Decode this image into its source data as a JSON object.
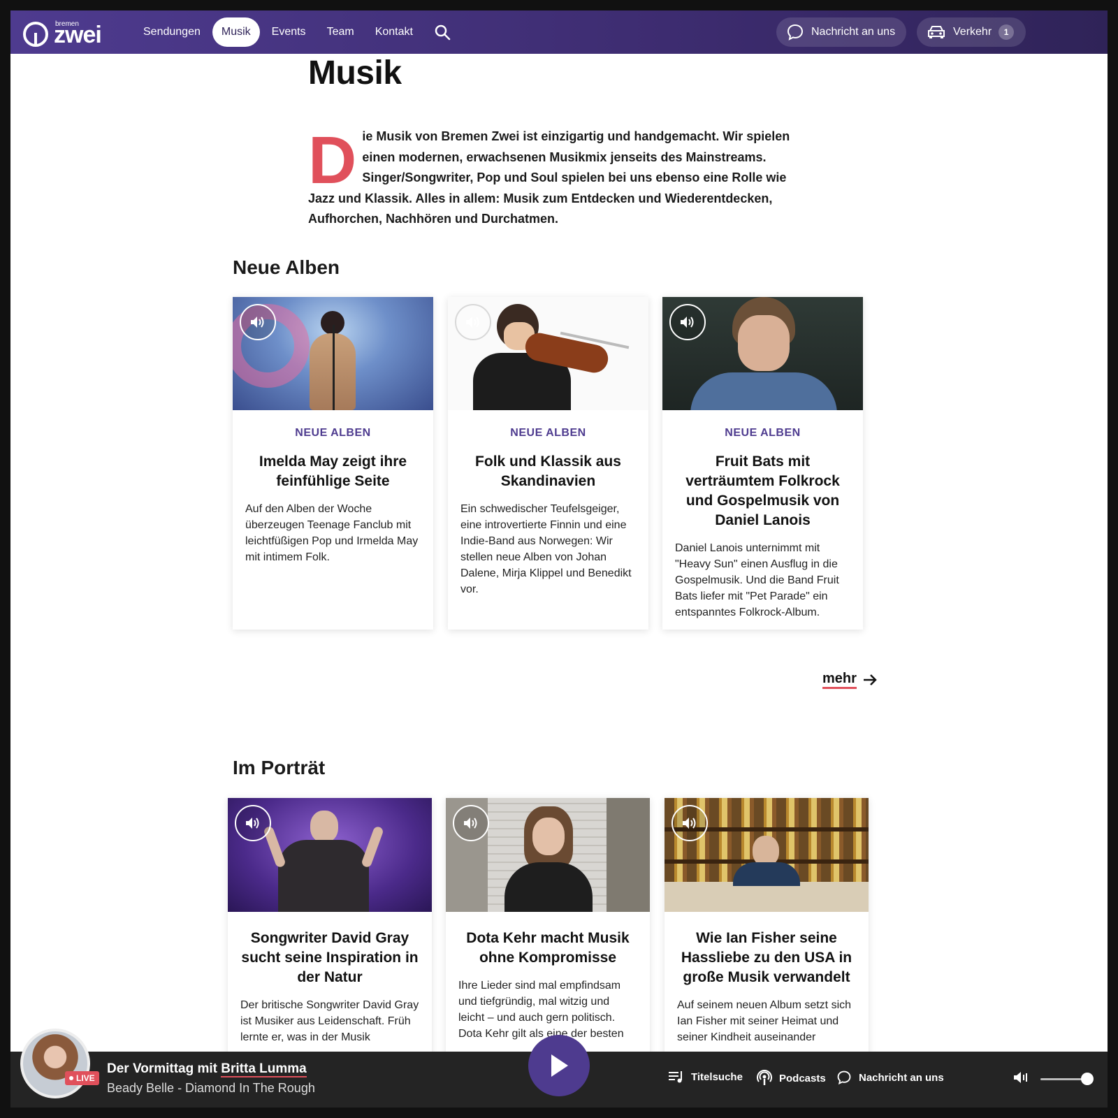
{
  "header": {
    "logo_small": "bremen",
    "logo_big": "zwei",
    "nav": [
      "Sendungen",
      "Musik",
      "Events",
      "Team",
      "Kontakt"
    ],
    "active_nav": "Musik",
    "message_label": "Nachricht an uns",
    "traffic_label": "Verkehr",
    "traffic_count": "1"
  },
  "page": {
    "title": "Musik",
    "intro_dropcap": "D",
    "intro_rest": "ie Musik von Bremen Zwei ist einzigartig und handgemacht. Wir spielen einen modernen, erwachsenen Musikmix jenseits des Mainstreams. Singer/Songwriter, Pop und Soul spielen bei uns ebenso eine Rolle wie Jazz und Klassik. Alles in allem: Musik zum Entdecken und Wiederentdecken, Aufhorchen, Nachhören und Durchatmen."
  },
  "neue_alben": {
    "section_title": "Neue Alben",
    "cards": [
      {
        "kicker": "NEUE ALBEN",
        "title": "Imelda May zeigt ihre feinfühlige Seite",
        "text": "Auf den Alben der Woche überzeugen Teenage Fanclub mit leichtfüßigen Pop und Irmelda May mit intimem Folk."
      },
      {
        "kicker": "NEUE ALBEN",
        "title": "Folk und Klassik aus Skandinavien",
        "text": "Ein schwedischer Teufelsgeiger, eine introvertierte Finnin und eine Indie-Band aus Norwegen: Wir stellen neue Alben von Johan Dalene, Mirja Klippel und Benedikt vor."
      },
      {
        "kicker": "NEUE ALBEN",
        "title": "Fruit Bats mit verträumtem Folkrock und Gospelmusik von Daniel Lanois",
        "text": "Daniel Lanois unternimmt mit \"Heavy Sun\" einen Ausflug in die Gospelmusik. Und die Band Fruit Bats liefer mit \"Pet Parade\" ein entspanntes Folkrock-Album."
      }
    ],
    "more_label": "mehr"
  },
  "portraet": {
    "section_title": "Im Porträt",
    "cards": [
      {
        "title": "Songwriter David Gray sucht seine Inspiration in der Natur",
        "text": "Der britische Songwriter David Gray ist Musiker aus Leidenschaft. Früh lernte er, was in der Musik"
      },
      {
        "title": "Dota Kehr macht Musik ohne Kompromisse",
        "text": "Ihre Lieder sind mal empfindsam und tiefgründig, mal witzig und leicht – und auch gern politisch. Dota Kehr gilt als eine der besten"
      },
      {
        "title": "Wie Ian Fisher seine Hassliebe zu den USA in große Musik verwandelt",
        "text": "Auf seinem neuen Album setzt sich Ian Fisher mit seiner Heimat und seiner Kindheit auseinander"
      }
    ]
  },
  "player": {
    "live_label": "LIVE",
    "show_prefix": "Der Vormittag mit ",
    "host": "Britta Lumma",
    "track": "Beady Belle - Diamond In The Rough",
    "links": [
      "Titelsuche",
      "Podcasts",
      "Nachricht an uns"
    ],
    "volume_level": 0.9
  },
  "colors": {
    "brand": "#4e3b8f",
    "accent": "#e0505b",
    "player_bg": "#242424"
  }
}
